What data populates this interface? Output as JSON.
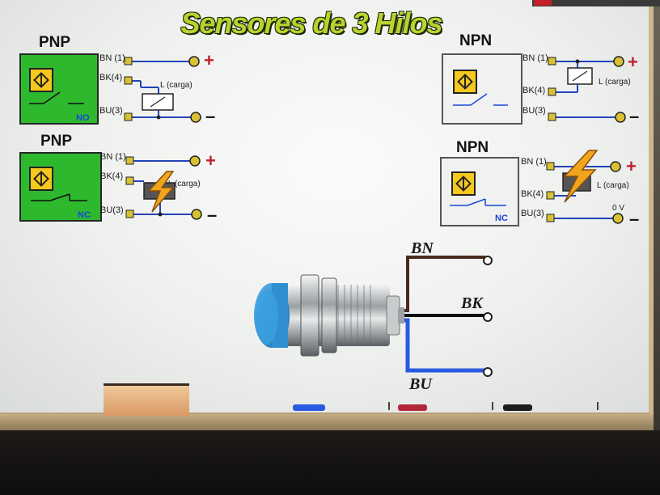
{
  "title": "Sensores de 3 Hilos",
  "diagrams": [
    {
      "type": "PNP",
      "contact": "NO",
      "pins": [
        "BN (1)",
        "BK(4)",
        "BU(3)"
      ],
      "load": "L (carga)",
      "supply": [
        "+",
        "–"
      ]
    },
    {
      "type": "PNP",
      "contact": "NC",
      "pins": [
        "BN (1)",
        "BK(4)",
        "BU(3)"
      ],
      "load": "L (carga)",
      "supply": [
        "+",
        "–"
      ]
    },
    {
      "type": "NPN",
      "contact": "",
      "pins": [
        "BN (1)",
        "BK(4)",
        "BU(3)"
      ],
      "load": "L (carga)",
      "supply": [
        "+",
        "–"
      ]
    },
    {
      "type": "NPN",
      "contact": "NC",
      "pins": [
        "BN (1)",
        "BK(4)",
        "BU(3)"
      ],
      "load": "L (carga)",
      "supply": [
        "+",
        "–"
      ],
      "zero_volt": "0 V"
    }
  ],
  "wires": {
    "bn": "BN",
    "bk": "BK",
    "bu": "BU"
  },
  "colors": {
    "title": "#b9d32e",
    "pnp_fill": "#2eb82e",
    "wire_blue": "#2444b8",
    "terminal": "#d8c233",
    "sensor_head": "#2f8fd0",
    "bn_wire": "#4a2a1e",
    "bk_wire": "#111111",
    "bu_wire": "#2a5ae0"
  },
  "icons": [
    "warning-lightning-icon",
    "inductive-sensor-icon",
    "switch-contact-icon",
    "relay-coil-icon"
  ]
}
